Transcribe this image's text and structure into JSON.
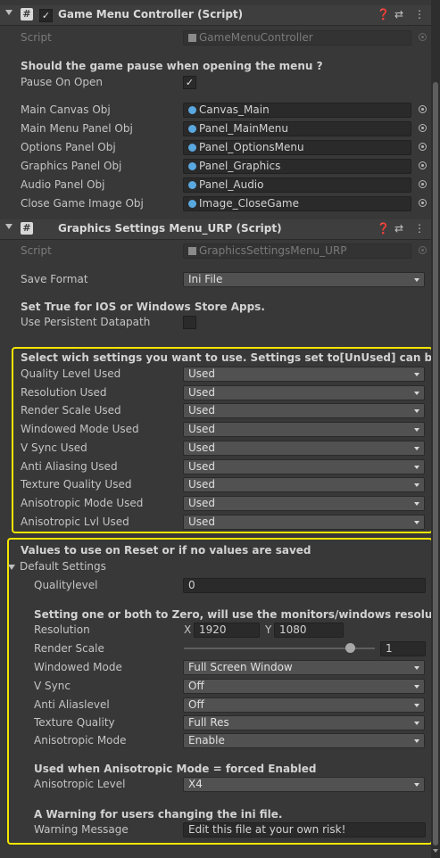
{
  "component1": {
    "title": "Game Menu Controller (Script)",
    "enabled_mark": "✓",
    "script_label": "Script",
    "script_value": "GameMenuController",
    "pause_heading": "Should the game pause when opening the menu ?",
    "pause_label": "Pause On Open",
    "pause_check": "✓",
    "refs": [
      {
        "label": "Main Canvas Obj",
        "value": "Canvas_Main"
      },
      {
        "label": "Main Menu Panel Obj",
        "value": "Panel_MainMenu"
      },
      {
        "label": "Options Panel Obj",
        "value": "Panel_OptionsMenu"
      },
      {
        "label": "Graphics Panel Obj",
        "value": "Panel_Graphics"
      },
      {
        "label": "Audio Panel Obj",
        "value": "Panel_Audio"
      },
      {
        "label": "Close Game Image Obj",
        "value": "Image_CloseGame"
      }
    ]
  },
  "component2": {
    "title": "Graphics Settings Menu_URP (Script)",
    "script_label": "Script",
    "script_value": "GraphicsSettingsMenu_URP",
    "save_format_label": "Save Format",
    "save_format_value": "Ini File",
    "persist_heading": "Set True for IOS or Windows Store Apps.",
    "persist_label": "Use Persistent Datapath",
    "used_heading": "Select wich settings you want to use. Settings set to[UnUsed] can be remo",
    "used_settings": [
      {
        "label": "Quality Level Used",
        "value": "Used"
      },
      {
        "label": "Resolution Used",
        "value": "Used"
      },
      {
        "label": "Render Scale Used",
        "value": "Used"
      },
      {
        "label": "Windowed Mode Used",
        "value": "Used"
      },
      {
        "label": "V Sync Used",
        "value": "Used"
      },
      {
        "label": "Anti Aliasing Used",
        "value": "Used"
      },
      {
        "label": "Texture Quality Used",
        "value": "Used"
      },
      {
        "label": "Anisotropic Mode Used",
        "value": "Used"
      },
      {
        "label": "Anisotropic Lvl Used",
        "value": "Used"
      }
    ],
    "reset_heading": "Values to use on Reset or if no values are saved",
    "default_settings_label": "Default Settings",
    "quality_label": "Qualitylevel",
    "quality_value": "0",
    "resolution_heading": "Setting one or both to Zero, will use the monitors/windows resolution.",
    "resolution_label": "Resolution",
    "res_x_label": "X",
    "res_x_value": "1920",
    "res_y_label": "Y",
    "res_y_value": "1080",
    "render_scale_label": "Render Scale",
    "render_scale_value": "1",
    "render_scale_fraction": 0.87,
    "defaults": [
      {
        "label": "Windowed Mode",
        "value": "Full Screen Window"
      },
      {
        "label": "V Sync",
        "value": "Off"
      },
      {
        "label": "Anti Aliaslevel",
        "value": "Off"
      },
      {
        "label": "Texture Quality",
        "value": "Full Res"
      },
      {
        "label": "Anisotropic Mode",
        "value": "Enable"
      }
    ],
    "aniso_heading": "Used when Anisotropic Mode = forced Enabled",
    "aniso_level_label": "Anisotropic Level",
    "aniso_level_value": "X4",
    "warning_heading": "A Warning for users changing the ini file.",
    "warning_label": "Warning Message",
    "warning_value": "Edit this file at your own risk!"
  },
  "colors": {
    "highlight_border": "#f4e600",
    "object_icon": "#5aa8e0"
  }
}
